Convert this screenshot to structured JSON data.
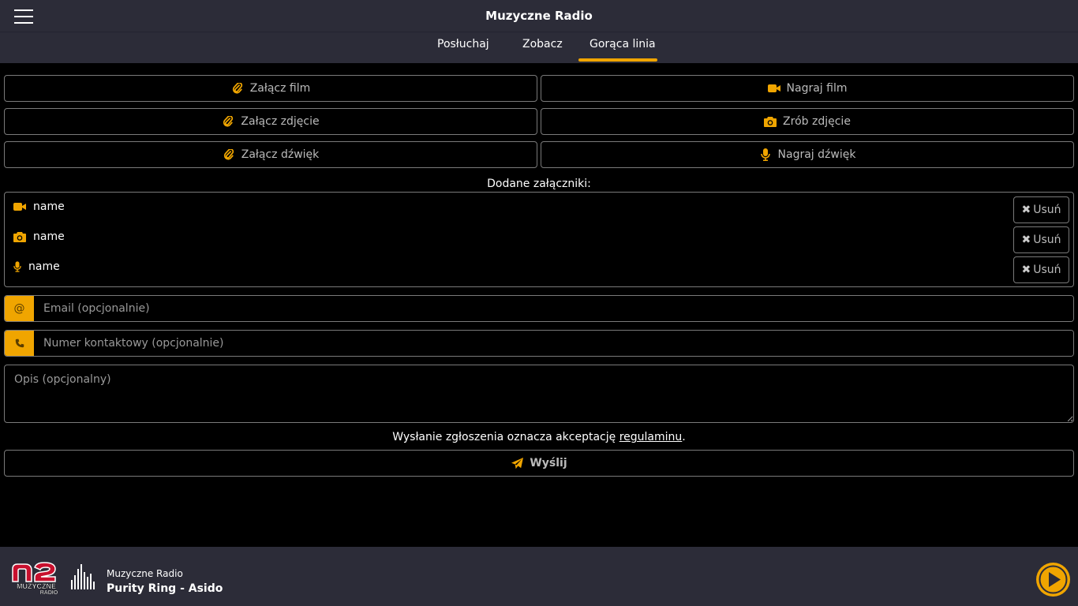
{
  "header": {
    "title": "Muzyczne Radio"
  },
  "tabs": [
    {
      "label": "Posłuchaj"
    },
    {
      "label": "Zobacz"
    },
    {
      "label": "Gorąca linia"
    }
  ],
  "actions": {
    "attach_film": "Załącz film",
    "record_film": "Nagraj film",
    "attach_photo": "Załącz zdjęcie",
    "take_photo": "Zrób zdjęcie",
    "attach_sound": "Załącz dźwięk",
    "record_sound": "Nagraj dźwięk"
  },
  "attachments": {
    "label": "Dodane załączniki:",
    "items": [
      {
        "icon": "video-camera-icon",
        "name": "name",
        "remove_label": "Usuń"
      },
      {
        "icon": "camera-icon",
        "name": "name",
        "remove_label": "Usuń"
      },
      {
        "icon": "microphone-icon",
        "name": "name",
        "remove_label": "Usuń"
      }
    ]
  },
  "form": {
    "email_placeholder": "Email (opcjonalnie)",
    "email_addon": "@",
    "phone_placeholder": "Numer kontaktowy (opcjonalnie)",
    "description_placeholder": "Opis (opcjonalny)",
    "terms_text": "Wysłanie zgłoszenia oznacza akceptację",
    "terms_link": "regulaminu",
    "terms_end": ".",
    "submit_label": "Wyślij"
  },
  "player": {
    "station": "Muzyczne Radio",
    "track": "Purity Ring - Asido",
    "logo_text": "MUZYCZNE RADIO"
  },
  "colors": {
    "accent": "#f0a500",
    "bar": "#2c2c38",
    "background": "#000000"
  }
}
